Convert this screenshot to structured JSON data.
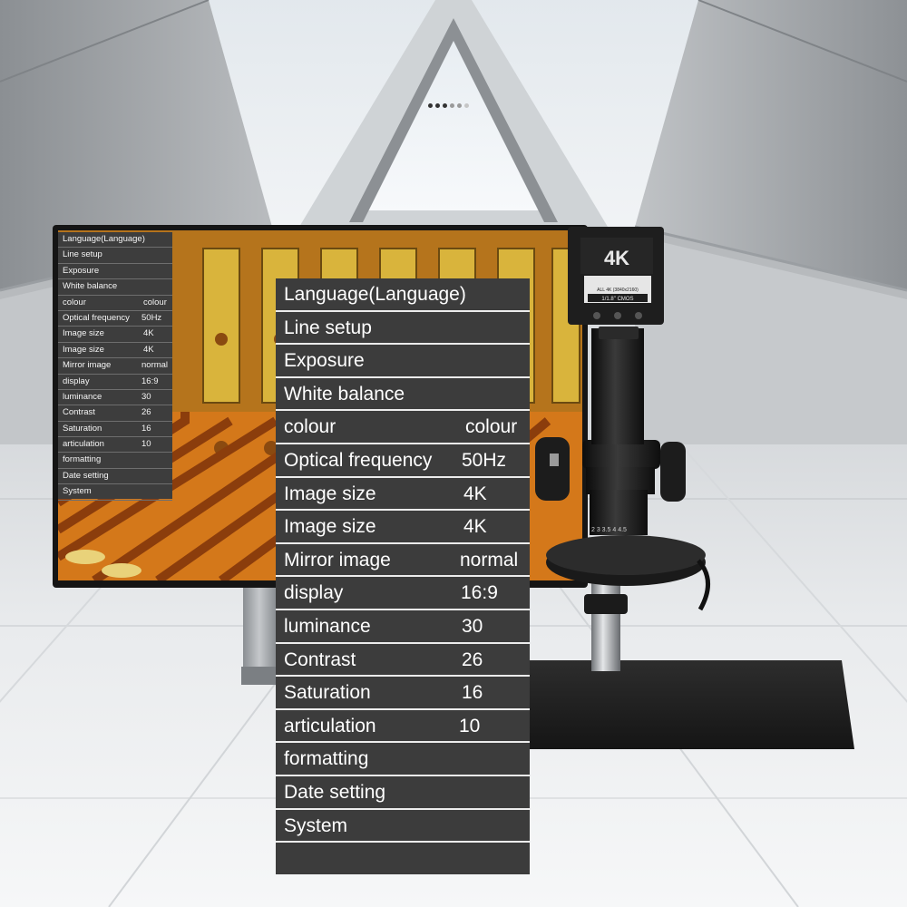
{
  "carousel": {
    "dots": [
      "dark",
      "dark",
      "dark",
      "light",
      "light",
      "lighter"
    ]
  },
  "camera": {
    "badge": "4K",
    "spec_line": "ALL 4K (3840x2160)",
    "sensor": "1/1.8\" CMOS"
  },
  "menu": {
    "items": [
      {
        "label": "Language(Language)",
        "value": ""
      },
      {
        "label": "Line setup",
        "value": ""
      },
      {
        "label": "Exposure",
        "value": ""
      },
      {
        "label": "White balance",
        "value": ""
      },
      {
        "label": "colour",
        "value": "colour"
      },
      {
        "label": "Optical frequency",
        "value": "50Hz"
      },
      {
        "label": "Image size",
        "value": "4K"
      },
      {
        "label": "Image size",
        "value": "4K"
      },
      {
        "label": "Mirror image",
        "value": "normal"
      },
      {
        "label": "display",
        "value": "16:9"
      },
      {
        "label": "luminance",
        "value": "30"
      },
      {
        "label": "Contrast",
        "value": "26"
      },
      {
        "label": "Saturation",
        "value": "16"
      },
      {
        "label": "articulation",
        "value": "10"
      },
      {
        "label": "formatting",
        "value": ""
      },
      {
        "label": "Date setting",
        "value": ""
      },
      {
        "label": "System",
        "value": ""
      }
    ]
  },
  "colors": {
    "menu_bg": "#3c3c3c",
    "menu_text": "#ffffff",
    "pcb_orange": "#d9801a",
    "pcb_gold": "#d8b23a"
  }
}
